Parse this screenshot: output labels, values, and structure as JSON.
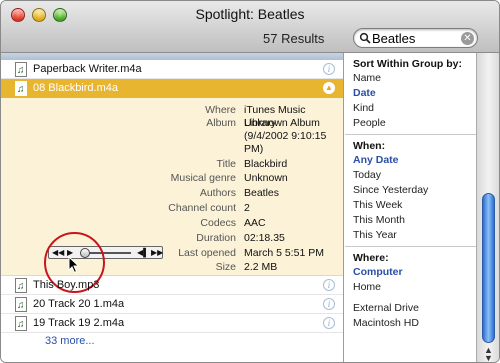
{
  "window": {
    "title": "Spotlight: Beatles",
    "results_count": "57 Results",
    "search": {
      "value": "Beatles",
      "placeholder": ""
    }
  },
  "results": {
    "rows_top": [
      {
        "name": "Paperback Writer.m4a"
      }
    ],
    "selected": {
      "name": "08 Blackbird.m4a"
    },
    "detail": [
      {
        "key": "Where",
        "value": "iTunes Music Library"
      },
      {
        "key": "Album",
        "value": "Unknown Album (9/4/2002 9:10:15 PM)"
      },
      {
        "key": "Title",
        "value": "Blackbird"
      },
      {
        "key": "Musical genre",
        "value": "Unknown"
      },
      {
        "key": "Authors",
        "value": "Beatles"
      },
      {
        "key": "Channel count",
        "value": "2"
      },
      {
        "key": "Codecs",
        "value": "AAC"
      },
      {
        "key": "Duration",
        "value": "02:18.35"
      },
      {
        "key": "Last opened",
        "value": "March 5 5:51 PM"
      },
      {
        "key": "Size",
        "value": "2.2 MB"
      }
    ],
    "rows_bottom": [
      {
        "name": "This Boy.mp3"
      },
      {
        "name": "20 Track 20 1.m4a"
      },
      {
        "name": "19 Track 19 2.m4a"
      }
    ],
    "more": "33 more..."
  },
  "sidebar": {
    "sort": {
      "title": "Sort Within Group by:",
      "options": [
        "Name",
        "Date",
        "Kind",
        "People"
      ],
      "selected": "Date"
    },
    "when": {
      "title": "When:",
      "options": [
        "Any Date",
        "Today",
        "Since Yesterday",
        "This Week",
        "This Month",
        "This Year"
      ],
      "selected": "Any Date"
    },
    "where": {
      "title": "Where:",
      "options": [
        "Computer",
        "Home",
        "External Drive",
        "Macintosh HD"
      ],
      "selected": "Computer"
    }
  },
  "colors": {
    "selection": "#e8b531",
    "detail_bg": "#fbf2d8",
    "link": "#2b4fa8",
    "highlight_circle": "#c8161d"
  },
  "icons": [
    "close-light",
    "minimize-light",
    "zoom-light",
    "search-icon",
    "clear-icon",
    "music-file-icon",
    "info-icon",
    "collapse-icon",
    "play-icon",
    "volume-icon",
    "pointer-cursor-icon"
  ]
}
